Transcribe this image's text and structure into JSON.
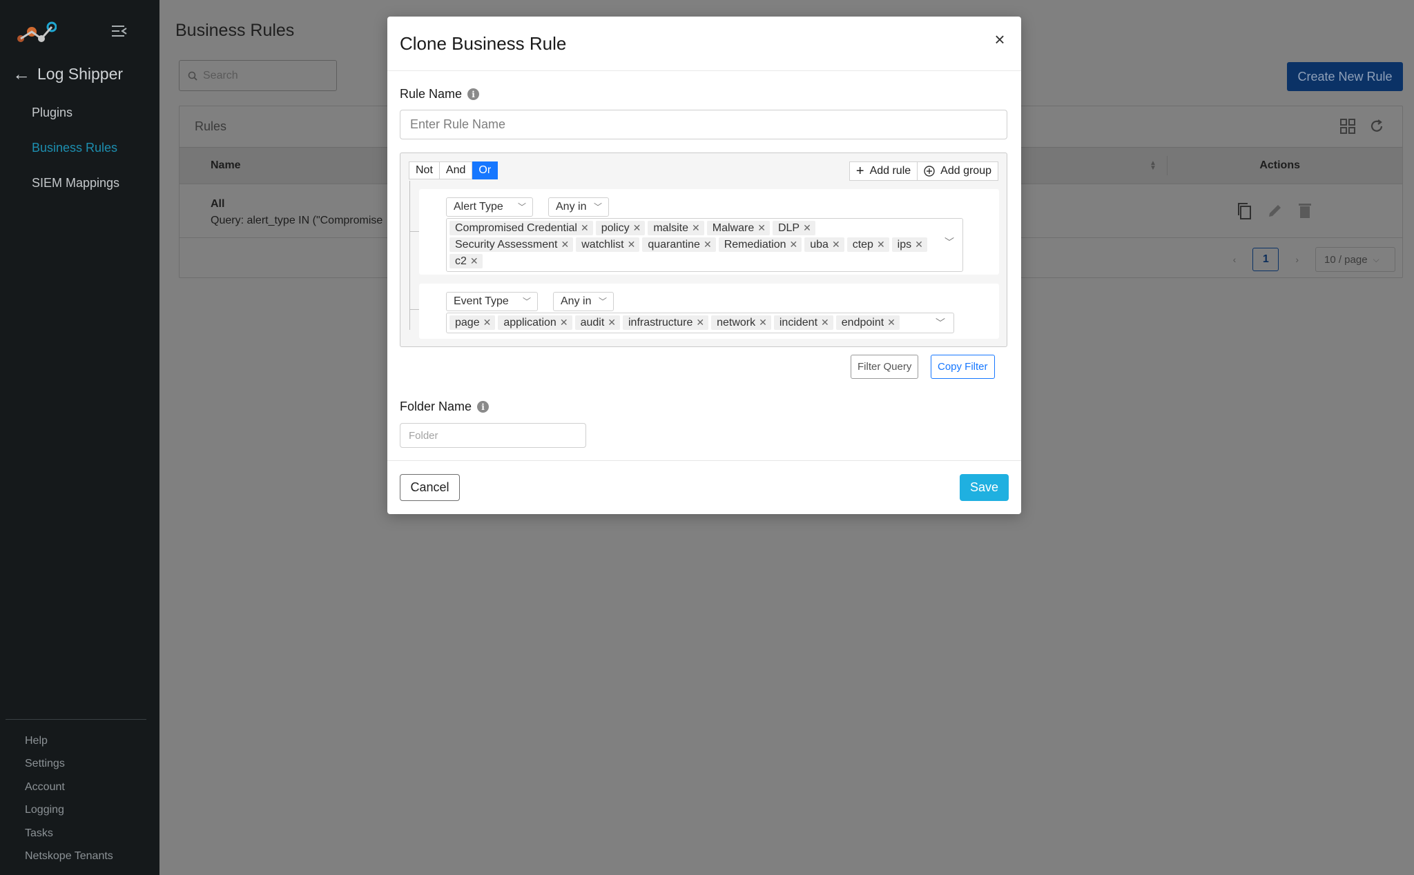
{
  "sidebar": {
    "app_title": "Log Shipper",
    "nav": [
      {
        "label": "Plugins",
        "active": false
      },
      {
        "label": "Business Rules",
        "active": true
      },
      {
        "label": "SIEM Mappings",
        "active": false
      }
    ],
    "bottom": [
      "Help",
      "Settings",
      "Account",
      "Logging",
      "Tasks",
      "Netskope Tenants"
    ]
  },
  "page": {
    "title": "Business Rules",
    "search_placeholder": "Search",
    "create_button": "Create New Rule",
    "card_title": "Rules",
    "columns": {
      "name": "Name",
      "actions": "Actions"
    },
    "rows": [
      {
        "name": "All",
        "query": "Query: alert_type IN (\"Compromise"
      }
    ],
    "pagination": {
      "current": "1",
      "page_size": "10 / page"
    }
  },
  "modal": {
    "title": "Clone Business Rule",
    "close": "×",
    "rule_name_label": "Rule Name",
    "rule_name_placeholder": "Enter Rule Name",
    "conjunctions": [
      {
        "label": "Not",
        "active": false
      },
      {
        "label": "And",
        "active": false
      },
      {
        "label": "Or",
        "active": true
      }
    ],
    "add_rule": "Add rule",
    "add_group": "Add group",
    "rules": [
      {
        "field": "Alert Type",
        "operator": "Any in",
        "values": [
          "Compromised Credential",
          "policy",
          "malsite",
          "Malware",
          "DLP",
          "Security Assessment",
          "watchlist",
          "quarantine",
          "Remediation",
          "uba",
          "ctep",
          "ips",
          "c2"
        ]
      },
      {
        "field": "Event Type",
        "operator": "Any in",
        "values": [
          "page",
          "application",
          "audit",
          "infrastructure",
          "network",
          "incident",
          "endpoint"
        ]
      }
    ],
    "filter_query": "Filter Query",
    "copy_filter": "Copy Filter",
    "folder_label": "Folder Name",
    "folder_placeholder": "Folder",
    "cancel": "Cancel",
    "save": "Save"
  },
  "colors": {
    "sidebar_bg": "#15191b",
    "active_nav": "#1d8fb0",
    "primary": "#1677ff",
    "save": "#1fb0e0"
  }
}
